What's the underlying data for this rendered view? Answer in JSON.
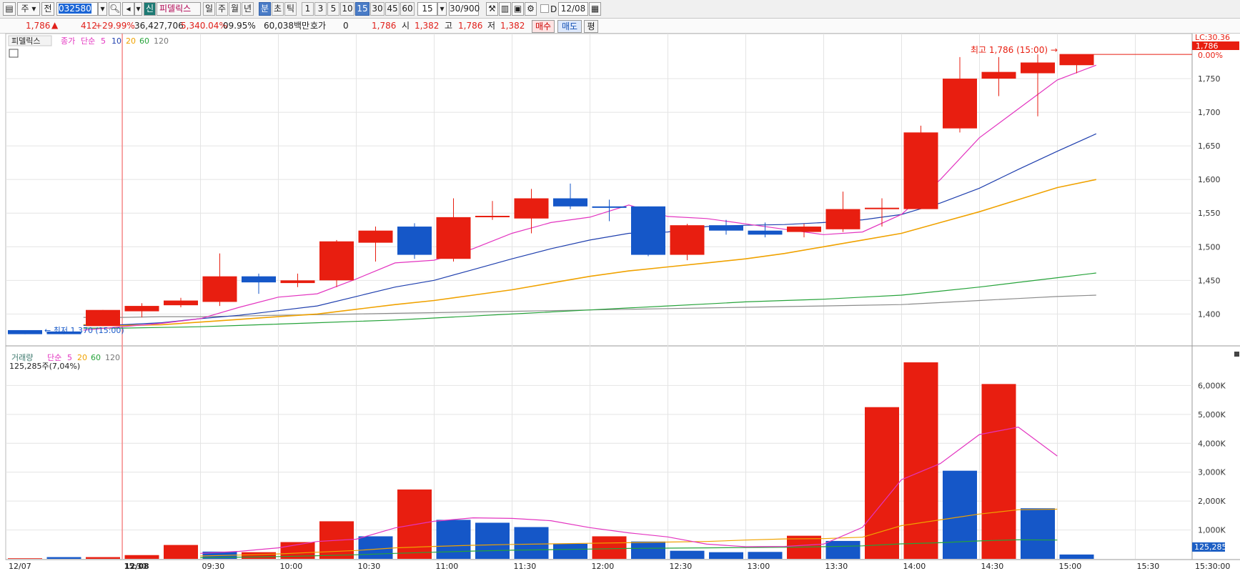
{
  "toolbar": {
    "mode_label": "주",
    "prev_label": "전",
    "code": "032580",
    "badge": "신",
    "name": "피델릭스",
    "period_tabs": [
      "일",
      "주",
      "월",
      "년",
      "분",
      "초",
      "틱"
    ],
    "interval_tabs": [
      "1",
      "3",
      "5",
      "10",
      "15",
      "30",
      "45",
      "60"
    ],
    "interval_value": "15",
    "count": "30/900",
    "checkbox_label": "D",
    "date": "12/08"
  },
  "quote": {
    "price": "1,786",
    "change": "412",
    "change_pct": "+29.99%",
    "volume": "36,427,706",
    "volume_pct": "5,340.04%",
    "turnover_pct": "09.95%",
    "amount": "60,038백만",
    "hoga_label": "호가",
    "hoga_value": "0",
    "hoga_price": "1,786",
    "open_label": "시",
    "open": "1,382",
    "high_label": "고",
    "high": "1,786",
    "low_label": "저",
    "low": "1,382",
    "buy_label": "매수",
    "sell_label": "매도",
    "flat_label": "평"
  },
  "colors": {
    "up": "#e81e10",
    "down": "#1557c8",
    "ma5": "#e334c0",
    "ma10": "#1f3fae",
    "ma20": "#f0a200",
    "ma60": "#26a33a",
    "ma120": "#8c8c8c"
  },
  "chart_data": [
    {
      "type": "candlestick",
      "legend": [
        "피델릭스",
        "종가",
        "단순",
        "5",
        "10",
        "20",
        "60",
        "120"
      ],
      "x": [
        "12/07 15:30",
        "12/08 09:00",
        "09:15",
        "09:30",
        "09:45",
        "10:00",
        "10:15",
        "10:30",
        "10:45",
        "11:00",
        "11:15",
        "11:30",
        "11:45",
        "12:00",
        "12:15",
        "12:30",
        "12:45",
        "13:00",
        "13:15",
        "13:30",
        "13:45",
        "14:00",
        "14:15",
        "14:30",
        "14:45",
        "15:00",
        "15:15",
        "15:30"
      ],
      "x_ticks": [
        "12/07",
        "15:30",
        "12/08",
        "09:30",
        "10:00",
        "10:30",
        "11:00",
        "11:30",
        "12:00",
        "12:30",
        "13:00",
        "13:30",
        "14:00",
        "14:30",
        "15:00",
        "15:30",
        "15:30:00"
      ],
      "y_ticks": [
        1400,
        1450,
        1500,
        1550,
        1600,
        1650,
        1700,
        1750
      ],
      "ylim": [
        1360,
        1800
      ],
      "ohlc": [
        [
          1376,
          1376,
          1370,
          1370
        ],
        [
          1374,
          1376,
          1370,
          1370
        ],
        [
          1382,
          1406,
          1382,
          1406
        ],
        [
          1404,
          1416,
          1395,
          1412
        ],
        [
          1413,
          1424,
          1410,
          1420
        ],
        [
          1418,
          1490,
          1412,
          1456
        ],
        [
          1456,
          1460,
          1430,
          1447
        ],
        [
          1446,
          1460,
          1440,
          1450
        ],
        [
          1450,
          1510,
          1440,
          1508
        ],
        [
          1506,
          1530,
          1478,
          1524
        ],
        [
          1530,
          1535,
          1482,
          1488
        ],
        [
          1482,
          1572,
          1478,
          1544
        ],
        [
          1544,
          1568,
          1540,
          1546
        ],
        [
          1542,
          1586,
          1520,
          1572
        ],
        [
          1572,
          1594,
          1556,
          1560
        ],
        [
          1560,
          1570,
          1538,
          1558
        ],
        [
          1560,
          1560,
          1486,
          1488
        ],
        [
          1488,
          1534,
          1480,
          1532
        ],
        [
          1532,
          1540,
          1518,
          1524
        ],
        [
          1524,
          1536,
          1514,
          1518
        ],
        [
          1522,
          1534,
          1514,
          1530
        ],
        [
          1526,
          1582,
          1522,
          1556
        ],
        [
          1556,
          1572,
          1530,
          1558
        ],
        [
          1556,
          1680,
          1556,
          1670
        ],
        [
          1676,
          1782,
          1670,
          1750
        ],
        [
          1750,
          1782,
          1724,
          1760
        ],
        [
          1758,
          1786,
          1694,
          1774
        ],
        [
          1770,
          1786,
          1758,
          1786
        ]
      ],
      "ma": {
        "5": [
          null,
          null,
          1376,
          1381,
          1386,
          1393,
          1410,
          1425,
          1430,
          1452,
          1476,
          1480,
          1497,
          1520,
          1536,
          1544,
          1562,
          1545,
          1542,
          1534,
          1526,
          1518,
          1522,
          1548,
          1600,
          1662,
          1705,
          1748,
          1770
        ],
        "10": [
          null,
          null,
          1383,
          1384,
          1387,
          1393,
          1398,
          1405,
          1412,
          1426,
          1440,
          1450,
          1466,
          1482,
          1497,
          1510,
          1520,
          1522,
          1530,
          1532,
          1533,
          1536,
          1540,
          1548,
          1565,
          1587,
          1615,
          1642,
          1668
        ],
        "20": [
          null,
          null,
          1384,
          1383,
          1384,
          1388,
          1392,
          1396,
          1400,
          1407,
          1414,
          1420,
          1428,
          1436,
          1446,
          1456,
          1464,
          1470,
          1476,
          1482,
          1490,
          1500,
          1510,
          1520,
          1536,
          1552,
          1570,
          1588,
          1600
        ],
        "60": [
          null,
          null,
          1379,
          1379,
          1380,
          1381,
          1383,
          1385,
          1387,
          1389,
          1391,
          1394,
          1397,
          1400,
          1403,
          1406,
          1409,
          1412,
          1415,
          1418,
          1420,
          1422,
          1425,
          1428,
          1434,
          1440,
          1447,
          1454,
          1461
        ],
        "120": [
          null,
          null,
          1395,
          1395,
          1396,
          1396,
          1397,
          1398,
          1399,
          1400,
          1401,
          1402,
          1403,
          1404,
          1405,
          1406,
          1407,
          1408,
          1409,
          1410,
          1411,
          1412,
          1413,
          1414,
          1417,
          1420,
          1423,
          1426,
          1428
        ]
      },
      "annotations": {
        "max_label": "최고 1,786 (15:00)",
        "min_label": "최저 1,370 (15:00)",
        "lc_label": "LC:30.36",
        "last_price": "1,786",
        "last_pct": "0.00%"
      }
    },
    {
      "type": "bar",
      "legend": [
        "거래량",
        "단순",
        "5",
        "20",
        "60",
        "120"
      ],
      "subtitle": "125,285주(7,04%)",
      "y_ticks": [
        1000,
        2000,
        3000,
        4000,
        5000,
        6000
      ],
      "y_tick_labels": [
        "1,000K",
        "2,000K",
        "3,000K",
        "4,000K",
        "5,000K",
        "6,000K"
      ],
      "ylim": [
        0,
        6900
      ],
      "values": [
        20,
        60,
        60,
        130,
        480,
        250,
        230,
        580,
        1300,
        780,
        2400,
        1350,
        1250,
        1100,
        520,
        780,
        600,
        280,
        230,
        240,
        800,
        620,
        5250,
        6800,
        3050,
        6050,
        1750,
        150
      ],
      "up": [
        true,
        false,
        true,
        true,
        true,
        false,
        true,
        true,
        true,
        false,
        true,
        false,
        false,
        false,
        false,
        true,
        false,
        false,
        false,
        false,
        true,
        false,
        true,
        true,
        false,
        true,
        false,
        false
      ],
      "ma5": [
        null,
        null,
        null,
        null,
        null,
        190,
        260,
        380,
        600,
        680,
        1070,
        1300,
        1420,
        1400,
        1320,
        1080,
        900,
        760,
        510,
        420,
        430,
        510,
        1090,
        2740,
        3300,
        4300,
        4560,
        3560
      ],
      "ma20": [
        null,
        null,
        null,
        null,
        null,
        100,
        130,
        170,
        230,
        290,
        380,
        430,
        470,
        500,
        520,
        540,
        560,
        580,
        600,
        650,
        690,
        700,
        750,
        1150,
        1350,
        1550,
        1700,
        1720
      ],
      "ma60": [
        null,
        null,
        null,
        null,
        null,
        40,
        60,
        80,
        110,
        140,
        190,
        230,
        270,
        300,
        320,
        340,
        360,
        370,
        380,
        390,
        400,
        420,
        450,
        520,
        560,
        620,
        660,
        650
      ],
      "last_value": "125,285"
    }
  ]
}
